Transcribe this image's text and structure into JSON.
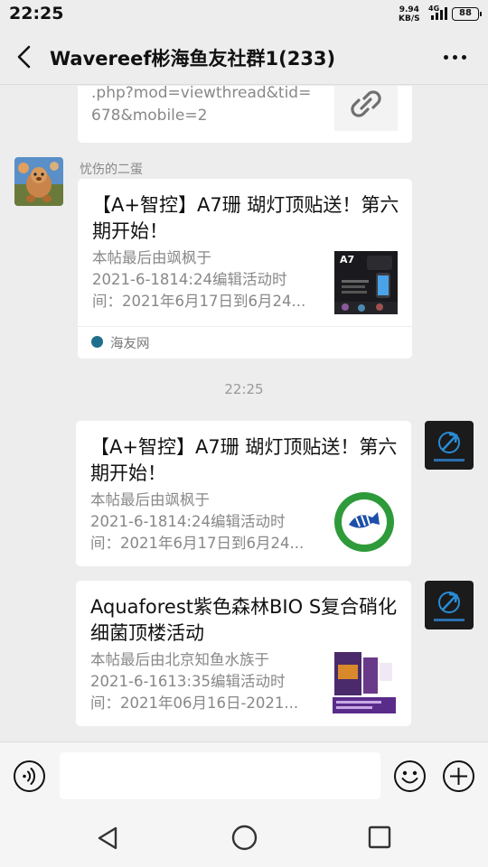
{
  "status_bar": {
    "time": "22:25",
    "net_speed_value": "9.94",
    "net_speed_unit": "KB/S",
    "network_type": "4G",
    "battery_level": "88"
  },
  "header": {
    "title": "Wavereef彬海鱼友社群1(233)",
    "back_icon": "back-arrow-icon",
    "more_icon": "more-dots-icon"
  },
  "messages": {
    "partial": {
      "line1": ".php?mod=viewthread&tid=",
      "line2": "678&mobile=2",
      "icon": "link-icon"
    },
    "msg1": {
      "sender": "忧伤的二蛋",
      "title": "【A+智控】A7珊 瑚灯顶贴送！第六期开始！",
      "desc_line1": "本帖最后由飒枫于",
      "desc_line2": "2021-6-1814:24编辑活动时",
      "desc_line3": "间：2021年6月17日到6月24...",
      "thumb_label": "A7",
      "source": "海友网"
    },
    "timestamp": "22:25",
    "msg2": {
      "title": "【A+智控】A7珊 瑚灯顶贴送！第六期开始！",
      "desc_line1": "本帖最后由飒枫于",
      "desc_line2": "2021-6-1814:24编辑活动时",
      "desc_line3": "间：2021年6月17日到6月24..."
    },
    "msg3": {
      "title": "Aquaforest紫色森林BIO S复合硝化细菌顶楼活动",
      "desc_line1": "本帖最后由北京知鱼水族于",
      "desc_line2": "2021-6-1613:35编辑活动时",
      "desc_line3": "间：2021年06月16日-2021..."
    }
  },
  "input_bar": {
    "placeholder": "",
    "voice_icon": "voice-icon",
    "emoji_icon": "emoji-icon",
    "plus_icon": "plus-icon"
  },
  "nav_bar": {
    "back_icon": "nav-back-icon",
    "home_icon": "nav-home-icon",
    "recent_icon": "nav-recent-icon"
  },
  "colors": {
    "background": "#ededed",
    "card": "#ffffff",
    "secondary_text": "#888888",
    "avatar_dark": "#1b1b1b",
    "avatar_accent": "#2a8cd6"
  }
}
